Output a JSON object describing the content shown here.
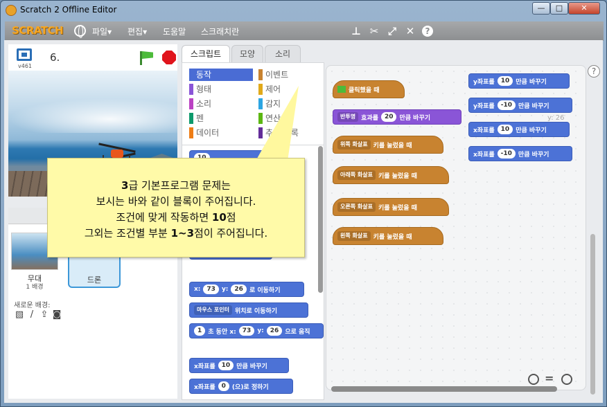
{
  "window": {
    "title": "Scratch 2 Offline Editor",
    "min": "—",
    "max": "□",
    "close": "✕"
  },
  "menubar": {
    "logo": "SCRATCH",
    "file": "파일▾",
    "edit": "편집▾",
    "help": "도움말",
    "tips": "스크래치란"
  },
  "stage": {
    "version": "v461",
    "project_name": "6."
  },
  "sprites": {
    "stage_label": "무대",
    "backdrop_count": "1 배경",
    "new_backdrop": "새로운 배경:",
    "sprite_name": "드론"
  },
  "tabs": {
    "scripts": "스크립트",
    "costumes": "모양",
    "sounds": "소리"
  },
  "categories": {
    "motion": "동작",
    "looks": "형태",
    "sound": "소리",
    "pen": "펜",
    "data": "데이터",
    "events": "이벤트",
    "control": "제어",
    "sensing": "감지",
    "operators": "연산",
    "more": "추가 블록"
  },
  "palette_blocks": {
    "b1_val": "10",
    "goto_x_label": "x:",
    "goto_x_val": "73",
    "goto_y_label": "y:",
    "goto_y_val": "26",
    "goto_end": "로 이동하기",
    "goto_target": "마우스 포인터",
    "goto_target_end": "위치로 이동하기",
    "glide_val": "1",
    "glide_mid": "초 동안 x:",
    "glide_x": "73",
    "glide_y_label": "y:",
    "glide_y": "26",
    "glide_end": "으로 움직",
    "change_x_pre": "x좌표를",
    "change_x_val": "10",
    "change_x_end": "만큼 바꾸기",
    "set_x_pre": "x좌표를",
    "set_x_val": "0",
    "set_x_end": "(으)로 정하기"
  },
  "scripts": {
    "flag_hat": "클릭했을 때",
    "effect_dd": "반투명",
    "effect_mid": "효과를",
    "effect_val": "20",
    "effect_end": "만큼 바꾸기",
    "key_up_dd": "위쪽 화살표",
    "key_down_dd": "아래쪽 화살표",
    "key_right_dd": "오른쪽 화살표",
    "key_left_dd": "왼쪽 화살표",
    "key_end": "키를 눌렀을 때",
    "y_pre": "y좌표를",
    "y_val1": "10",
    "y_val2": "-10",
    "x_pre": "x좌표를",
    "x_val1": "10",
    "x_val2": "-10",
    "change_end": "만큼 바꾸기",
    "coord_y": "y: 26"
  },
  "callout": {
    "line1_bold": "3",
    "line1": "급 기본프로그램 문제는",
    "line2": "보시는 바와 같이 블록이 주어집니다.",
    "line3": "조건에 맞게 작동하면 ",
    "line3_bold": "10",
    "line3_end": "점",
    "line4": "그외는 조건별 부분 ",
    "line4_bold": "1~3",
    "line4_end": "점이 주어집니다."
  },
  "colors": {
    "motion": "#4a6cd4",
    "looks": "#8a55d7",
    "sound": "#bb42c3",
    "pen": "#0e9a6c",
    "data": "#ee7d16",
    "events": "#c88330",
    "control": "#e1a91a",
    "sensing": "#2ca5e2",
    "operators": "#5cb712",
    "more": "#632d99",
    "callout": "#fffaa8"
  }
}
